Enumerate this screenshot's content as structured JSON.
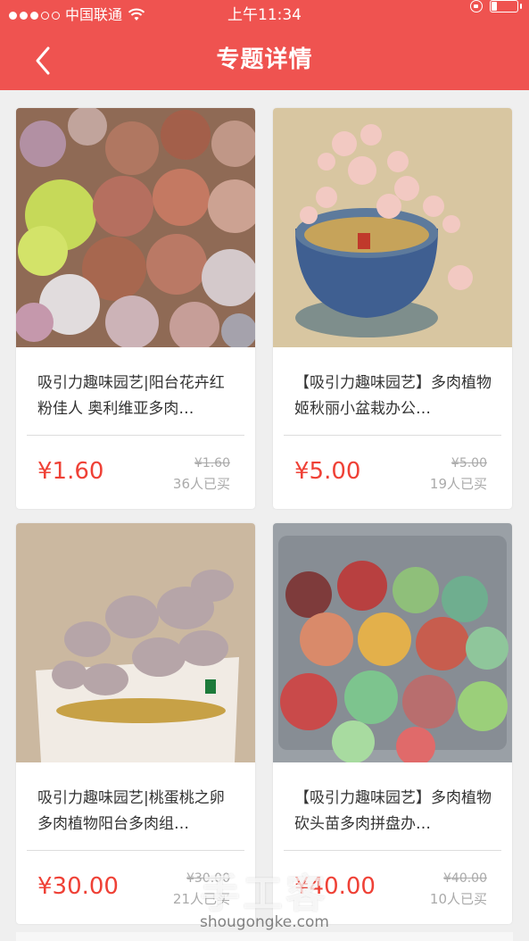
{
  "status_bar": {
    "carrier": "中国联通",
    "time": "上午11:34",
    "battery_level": 0.2
  },
  "nav": {
    "title": "专题详情"
  },
  "products": [
    {
      "title": "吸引力趣味园艺|阳台花卉红粉佳人 奥利维亚多肉…",
      "price": "¥1.60",
      "old_price": "¥1.60",
      "sold": "36人已买"
    },
    {
      "title": "【吸引力趣味园艺】多肉植物姬秋丽小盆栽办公…",
      "price": "¥5.00",
      "old_price": "¥5.00",
      "sold": "19人已买"
    },
    {
      "title": "吸引力趣味园艺|桃蛋桃之卵多肉植物阳台多肉组…",
      "price": "¥30.00",
      "old_price": "¥30.00",
      "sold": "21人已买"
    },
    {
      "title": "【吸引力趣味园艺】多肉植物砍头苗多肉拼盘办…",
      "price": "¥40.00",
      "old_price": "¥40.00",
      "sold": "10人已买"
    }
  ],
  "watermark": {
    "cn": "手工客",
    "en": "shougongke.com"
  },
  "colors": {
    "header": "#ef5350",
    "price": "#ef4136"
  }
}
